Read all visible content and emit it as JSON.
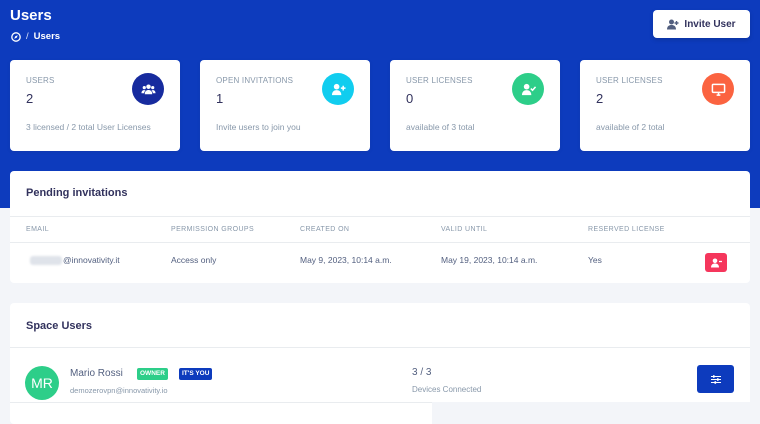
{
  "header": {
    "title": "Users",
    "breadcrumb_current": "Users",
    "breadcrumb_sep": "/",
    "invite_button": "Invite User"
  },
  "stats": [
    {
      "label": "USERS",
      "value": "2",
      "sub": "3 licensed / 2 total User Licenses",
      "icon": "users-icon",
      "color": "#172b9e"
    },
    {
      "label": "OPEN INVITATIONS",
      "value": "1",
      "sub": "Invite users to join you",
      "icon": "user-plus-icon",
      "color": "#11cdef"
    },
    {
      "label": "USER LICENSES",
      "value": "0",
      "sub": "available of 3 total",
      "icon": "user-check-icon",
      "color": "#2dce89"
    },
    {
      "label": "USER LICENSES",
      "value": "2",
      "sub": "available of 2 total",
      "icon": "monitor-icon",
      "color": "#fb6340"
    }
  ],
  "pending": {
    "title": "Pending invitations",
    "columns": [
      "EMAIL",
      "PERMISSION GROUPS",
      "CREATED ON",
      "VALID UNTIL",
      "RESERVED LICENSE"
    ],
    "rows": [
      {
        "email": "@innovativity.it",
        "groups": "Access only",
        "created": "May 9, 2023, 10:14 a.m.",
        "valid": "May 19, 2023, 10:14 a.m.",
        "reserved": "Yes"
      }
    ]
  },
  "space_users": {
    "title": "Space Users",
    "users": [
      {
        "initials": "MR",
        "name": "Mario Rossi",
        "badge_owner": "OWNER",
        "badge_you": "IT'S YOU",
        "email": "demozerovpn@innovativity.io",
        "devices": "3 / 3",
        "devices_label": "Devices Connected"
      }
    ]
  },
  "colors": {
    "brand": "#0d3bbd",
    "danger": "#f5365c",
    "success": "#2dce89",
    "info": "#11cdef",
    "warning": "#fb6340"
  }
}
